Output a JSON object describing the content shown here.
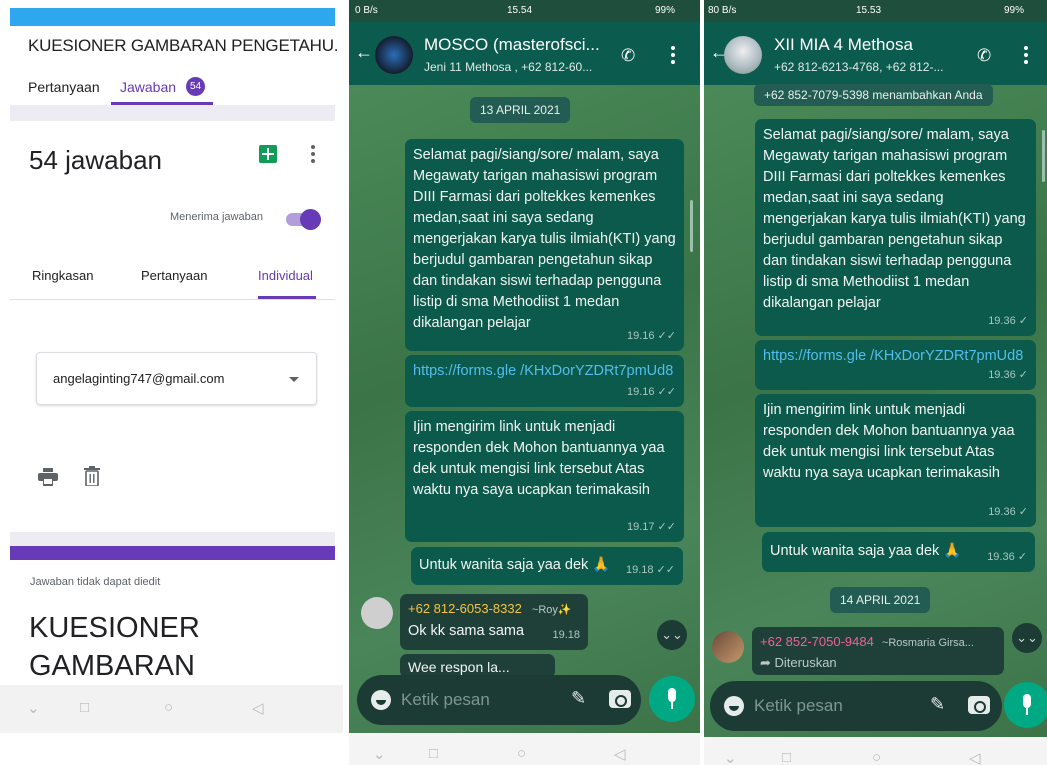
{
  "forms": {
    "title": "KUESIONER GAMBARAN PENGETAHU.",
    "tabs": [
      {
        "label": "Pertanyaan"
      },
      {
        "label": "Jawaban"
      }
    ],
    "responses_badge": "54",
    "response_count": "54 jawaban",
    "accepting_label": "Menerima jawaban",
    "accepting_on": true,
    "subtabs": [
      {
        "label": "Ringkasan"
      },
      {
        "label": "Pertanyaan"
      },
      {
        "label": "Individual"
      }
    ],
    "selected_email": "angelaginting747@gmail.com",
    "cannot_edit_note": "Jawaban tidak dapat diedit",
    "form_heading": "KUESIONER GAMBARAN"
  },
  "chat1": {
    "status_left": "0 B/s",
    "status_time": "15.54",
    "status_battery": "99%",
    "title": "MOSCO (masterofsci...",
    "subtitle": "Jeni 11 Methosa , +62 812-60...",
    "date_chip": "13 APRIL 2021",
    "messages": [
      {
        "text": "Selamat pagi/siang/sore/ malam, saya Megawaty tarigan mahasiswi program DIII Farmasi dari poltekkes kemenkes medan,saat ini saya sedang mengerjakan karya tulis ilmiah(KTI) yang berjudul gambaran pengetahun sikap dan tindakan siswi terhadap pengguna listip di sma Methodiist 1 medan dikalangan pelajar",
        "time": "19.16 ✓✓"
      },
      {
        "text": "https://forms.gle /KHxDorYZDRt7pmUd8",
        "time": "19.16 ✓✓"
      },
      {
        "text": "Ijin mengirim link untuk menjadi responden dek Mohon bantuannya yaa dek untuk mengisi link tersebut Atas waktu nya saya ucapkan terimakasih",
        "time": "19.17 ✓✓"
      },
      {
        "text": "Untuk wanita saja yaa dek 🙏",
        "time": "19.18 ✓✓"
      }
    ],
    "incoming": {
      "sender": "+62 812-6053-8332",
      "alias": "~Roy✨",
      "text": "Ok kk sama sama",
      "time": "19.18"
    },
    "incoming2": {
      "text": "Wee respon la..."
    },
    "composer_placeholder": "Ketik pesan"
  },
  "chat2": {
    "status_left": "80 B/s",
    "status_time": "15.53",
    "status_battery": "99%",
    "title": "XII MIA 4 Methosa",
    "subtitle": "+62 812-6213-4768, +62 812-...",
    "system_msg": "+62 852-7079-5398 menambahkan Anda",
    "messages": [
      {
        "text": "Selamat pagi/siang/sore/ malam, saya Megawaty tarigan mahasiswi program DIII Farmasi dari poltekkes kemenkes medan,saat ini saya sedang mengerjakan karya tulis ilmiah(KTI) yang berjudul gambaran pengetahun sikap dan tindakan siswi terhadap pengguna listip di sma Methodiist 1 medan dikalangan pelajar",
        "time": "19.36 ✓"
      },
      {
        "text": "https://forms.gle /KHxDorYZDRt7pmUd8",
        "time": "19.36 ✓"
      },
      {
        "text": "Ijin mengirim link untuk menjadi responden dek Mohon bantuannya yaa dek untuk mengisi link tersebut Atas waktu nya saya ucapkan terimakasih",
        "time": "19.36 ✓"
      },
      {
        "text": "Untuk wanita saja yaa dek 🙏",
        "time": "19.36 ✓"
      }
    ],
    "date_chip": "14 APRIL 2021",
    "incoming": {
      "sender": "+62 852-7050-9484",
      "alias": "~Rosmaria Girsa...",
      "forwarded": "Diteruskan"
    },
    "composer_placeholder": "Ketik pesan"
  },
  "colors": {
    "forms_accent": "#673ab7",
    "wa_header": "#0c5b4f",
    "wa_bubble": "#0b5a4c",
    "wa_mic": "#00a884"
  }
}
